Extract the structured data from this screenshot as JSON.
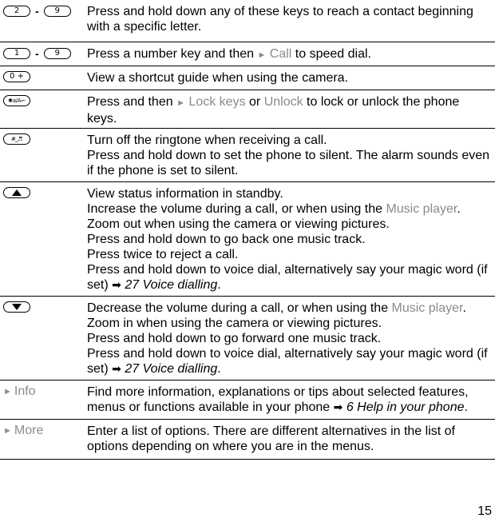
{
  "rows": [
    {
      "key": {
        "type": "range",
        "from": "2",
        "to": "9",
        "separator": "-"
      },
      "lines": [
        {
          "text": "Press and hold down any of these keys to reach a contact beginning with a specific letter."
        }
      ]
    },
    {
      "key": {
        "type": "range",
        "from": "1",
        "to": "9",
        "separator": "-"
      },
      "lines": [
        {
          "pre": "Press a number key and then ",
          "arrow": "►",
          "menu": "Call",
          "post": " to speed dial."
        }
      ]
    },
    {
      "key": {
        "type": "single",
        "label": "0 +",
        "icon": "zero-plus-key-icon"
      },
      "lines": [
        {
          "text": "View a shortcut guide when using the camera."
        }
      ]
    },
    {
      "key": {
        "type": "single",
        "label": "✱a/A⌐",
        "icon": "star-key-icon"
      },
      "lines": [
        {
          "pre": "Press and then ",
          "arrow": "►",
          "menu": "Lock keys",
          "mid": " or ",
          "menu2": "Unlock",
          "post": " to lock or unlock the phone keys."
        }
      ]
    },
    {
      "key": {
        "type": "single",
        "label": "#⎵♬",
        "icon": "hash-key-icon"
      },
      "lines": [
        {
          "text": "Turn off the ringtone when receiving a call."
        },
        {
          "text": "Press and hold down to set the phone to silent. The alarm sounds even if the phone is set to silent."
        }
      ]
    },
    {
      "key": {
        "type": "nav",
        "icon": "volume-up-key-icon",
        "direction": "up"
      },
      "lines": [
        {
          "text": "View status information in standby."
        },
        {
          "pre": "Increase the volume during a call, or when using the ",
          "menu": "Music player",
          "post": "."
        },
        {
          "text": "Zoom out when using the camera or viewing pictures."
        },
        {
          "text": "Press and hold down to go back one music track."
        },
        {
          "text": "Press twice to reject a call."
        },
        {
          "pre": "Press and hold down to voice dial, alternatively say your magic word (if set) ",
          "ref_arrow": "➡",
          "ref": "27 Voice dialling",
          "post": "."
        }
      ]
    },
    {
      "key": {
        "type": "nav",
        "icon": "volume-down-key-icon",
        "direction": "down"
      },
      "lines": [
        {
          "pre": "Decrease the volume during a call, or when using the ",
          "menu": "Music player",
          "post": "."
        },
        {
          "text": "Zoom in when using the camera or viewing pictures."
        },
        {
          "text": "Press and hold down to go forward one music track."
        },
        {
          "pre": "Press and hold down to voice dial, alternatively say your magic word (if set) ",
          "ref_arrow": "➡",
          "ref": "27 Voice dialling",
          "post": "."
        }
      ]
    },
    {
      "key": {
        "type": "softkey",
        "arrow": "►",
        "label": "Info"
      },
      "lines": [
        {
          "pre": "Find more information, explanations or tips about selected features, menus or functions available in your phone ",
          "ref_arrow": "➡",
          "ref": "6 Help in your phone",
          "post": "."
        }
      ]
    },
    {
      "key": {
        "type": "softkey",
        "arrow": "►",
        "label": "More"
      },
      "lines": [
        {
          "text": "Enter a list of options. There are different alternatives in the list of options depending on where you are in the menus."
        }
      ]
    }
  ],
  "page_number": "15",
  "colors": {
    "menu_text": "#8a8a8a",
    "text": "#000000",
    "rule": "#000000"
  }
}
